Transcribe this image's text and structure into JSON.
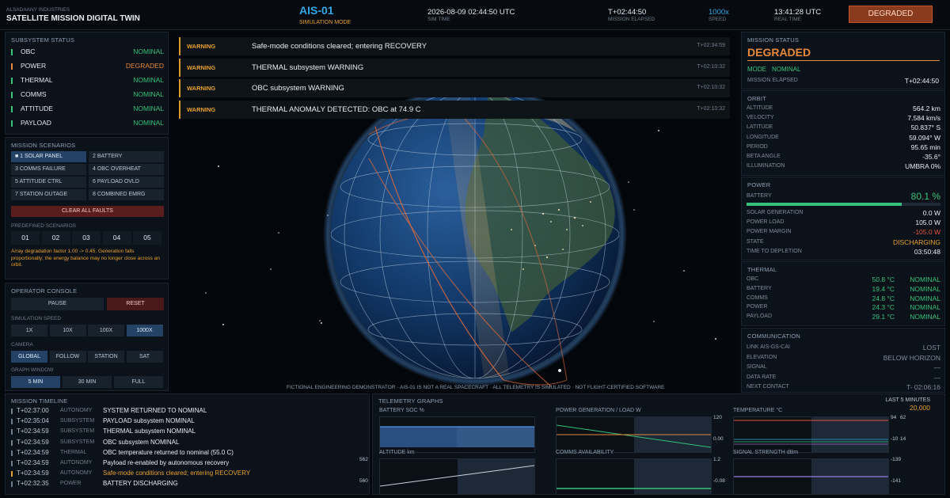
{
  "header": {
    "org": "ALSADAANY INDUSTRIES",
    "app_title": "SATELLITE MISSION DIGITAL TWIN",
    "sat_id": "AIS-01",
    "mode": "SIMULATION MODE",
    "sim_time": "2026-08-09 02:44:50 UTC",
    "sim_time_label": "SIM TIME",
    "elapsed": "T+02:44:50",
    "elapsed_label": "MISSION ELAPSED",
    "speed": "1000x",
    "speed_label": "SPEED",
    "real_time": "13:41:28 UTC",
    "real_time_label": "REAL TIME",
    "status_badge": "DEGRADED"
  },
  "subsystems": {
    "title": "SUBSYSTEM STATUS",
    "items": [
      {
        "name": "OBC",
        "status": "NOMINAL"
      },
      {
        "name": "POWER",
        "status": "DEGRADED"
      },
      {
        "name": "THERMAL",
        "status": "NOMINAL"
      },
      {
        "name": "COMMS",
        "status": "NOMINAL"
      },
      {
        "name": "ATTITUDE",
        "status": "NOMINAL"
      },
      {
        "name": "PAYLOAD",
        "status": "NOMINAL"
      }
    ]
  },
  "scenarios": {
    "title": "MISSION SCENARIOS",
    "items": [
      "■ 1 SOLAR PANEL",
      "2 BATTERY",
      "3 COMMS FAILURE",
      "4 OBC OVERHEAT",
      "5 ATTITUDE CTRL",
      "6 PAYLOAD OVLD",
      "7 STATION OUTAGE",
      "8 COMBINED EMRG"
    ],
    "clear_label": "CLEAR ALL FAULTS",
    "predefined_label": "PREDEFINED SCENARIOS",
    "predefined": [
      "01",
      "02",
      "03",
      "04",
      "05"
    ],
    "note": "Array degradation factor 1.00 -> 0.45. Generation falls proportionally; the energy balance may no longer close across an orbit."
  },
  "console": {
    "title": "OPERATOR CONSOLE",
    "pause": "PAUSE",
    "reset": "RESET",
    "speed_label": "SIMULATION SPEED",
    "speeds": [
      "1X",
      "10X",
      "100X",
      "1000X"
    ],
    "camera_label": "CAMERA",
    "cameras": [
      "GLOBAL",
      "FOLLOW",
      "STATION",
      "SAT"
    ],
    "window_label": "GRAPH WINDOW",
    "windows": [
      "5 MIN",
      "30 MIN",
      "FULL"
    ]
  },
  "warnings": [
    {
      "level": "WARNING",
      "msg": "Safe-mode conditions cleared; entering RECOVERY",
      "time": "T+02:34:59"
    },
    {
      "level": "WARNING",
      "msg": "THERMAL subsystem WARNING",
      "time": "T+02:10:32"
    },
    {
      "level": "WARNING",
      "msg": "OBC subsystem WARNING",
      "time": "T+02:10:32"
    },
    {
      "level": "WARNING",
      "msg": "THERMAL ANOMALY DETECTED: OBC at 74.9 C",
      "time": "T+02:10:32"
    }
  ],
  "disclaimer": "FICTIONAL ENGINEERING DEMONSTRATOR  ·  AIS-01 IS NOT A REAL SPACECRAFT  ·  ALL TELEMETRY IS SIMULATED  ·  NOT FLIGHT-CERTIFIED SOFTWARE",
  "mission_status": {
    "title": "MISSION STATUS",
    "state": "DEGRADED",
    "mode_label": "MODE",
    "mode": "NOMINAL",
    "elapsed_label": "MISSION ELAPSED",
    "elapsed": "T+02:44:50"
  },
  "orbit": {
    "title": "ORBIT",
    "rows": [
      {
        "k": "ALTITUDE",
        "v": "564.2 km"
      },
      {
        "k": "VELOCITY",
        "v": "7.584 km/s"
      },
      {
        "k": "LATITUDE",
        "v": "50.837° S"
      },
      {
        "k": "LONGITUDE",
        "v": "59.094° W"
      },
      {
        "k": "PERIOD",
        "v": "95.65 min"
      },
      {
        "k": "BETA ANGLE",
        "v": "-35.6°"
      }
    ],
    "illum_label": "ILLUMINATION",
    "illum": "UMBRA  0%"
  },
  "power": {
    "title": "POWER",
    "battery_label": "BATTERY",
    "battery": "80.1 %",
    "battery_fraction": 0.801,
    "rows": [
      {
        "k": "SOLAR GENERATION",
        "v": "0.0 W"
      },
      {
        "k": "POWER LOAD",
        "v": "105.0 W"
      },
      {
        "k": "POWER MARGIN",
        "v": "-105.0 W"
      },
      {
        "k": "STATE",
        "v": "DISCHARGING"
      },
      {
        "k": "TIME TO DEPLETION",
        "v": "03:50:48"
      }
    ]
  },
  "thermal": {
    "title": "THERMAL",
    "rows": [
      {
        "k": "OBC",
        "t": "50.8 °C",
        "s": "NOMINAL"
      },
      {
        "k": "BATTERY",
        "t": "19.4 °C",
        "s": "NOMINAL"
      },
      {
        "k": "COMMS",
        "t": "24.8 °C",
        "s": "NOMINAL"
      },
      {
        "k": "POWER",
        "t": "24.3 °C",
        "s": "NOMINAL"
      },
      {
        "k": "PAYLOAD",
        "t": "29.1 °C",
        "s": "NOMINAL"
      }
    ]
  },
  "comms": {
    "title": "COMMUNICATION",
    "rows": [
      {
        "k": "LINK  AIS-GS-CAI",
        "v": "LOST"
      },
      {
        "k": "ELEVATION",
        "v": "BELOW HORIZON"
      },
      {
        "k": "SIGNAL",
        "v": "—"
      },
      {
        "k": "DATA RATE",
        "v": "—"
      },
      {
        "k": "NEXT CONTACT",
        "v": "T- 02:06:16"
      }
    ]
  },
  "timeline": {
    "title": "MISSION TIMELINE",
    "rows": [
      {
        "t": "T+02:37:00",
        "c": "AUTONOMY",
        "m": "SYSTEM RETURNED TO NOMINAL",
        "color": "#6d7d8c"
      },
      {
        "t": "T+02:35:04",
        "c": "SUBSYSTEM",
        "m": "PAYLOAD subsystem NOMINAL",
        "color": "#6d7d8c"
      },
      {
        "t": "T+02:34:59",
        "c": "SUBSYSTEM",
        "m": "THERMAL subsystem NOMINAL",
        "color": "#6d7d8c"
      },
      {
        "t": "T+02:34:59",
        "c": "SUBSYSTEM",
        "m": "OBC subsystem NOMINAL",
        "color": "#6d7d8c"
      },
      {
        "t": "T+02:34:59",
        "c": "THERMAL",
        "m": "OBC temperature returned to nominal (55.0 C)",
        "color": "#6d7d8c"
      },
      {
        "t": "T+02:34:59",
        "c": "AUTONOMY",
        "m": "Payload re-enabled by autonomous recovery",
        "color": "#6d7d8c"
      },
      {
        "t": "T+02:34:59",
        "c": "AUTONOMY",
        "m": "Safe-mode conditions cleared; entering RECOVERY",
        "color": "#e8a030"
      },
      {
        "t": "T+02:32:35",
        "c": "POWER",
        "m": "BATTERY DISCHARGING",
        "color": "#6d7d8c"
      }
    ]
  },
  "telemetry": {
    "title": "TELEMETRY GRAPHS",
    "window": "LAST 5 MINUTES",
    "counter": "20,000",
    "graphs": [
      {
        "title": "BATTERY SOC  %",
        "ymax": "",
        "ymin": "",
        "y2max": "",
        "y2min": ""
      },
      {
        "title": "POWER  GENERATION / LOAD  W",
        "ymax": "120",
        "ymin": "0.00",
        "y2max": "",
        "y2min": ""
      },
      {
        "title": "TEMPERATURE  °C",
        "ymax": "94",
        "ymin": "-10",
        "y2max": "62",
        "y2min": "14"
      },
      {
        "title": "ALTITUDE  km",
        "ymax": "",
        "ymin": "",
        "y2max": "562",
        "y2min": "560"
      },
      {
        "title": "COMMS AVAILABILITY",
        "ymax": "1.2",
        "ymin": "-0.08",
        "y2max": "",
        "y2min": ""
      },
      {
        "title": "SIGNAL STRENGTH  dBm",
        "ymax": "-139",
        "ymin": "-141",
        "y2max": "",
        "y2min": ""
      }
    ]
  },
  "colors": {
    "nominal": "#35c27a",
    "degraded": "#e8893a",
    "warning": "#e8a030",
    "accent": "#33a8e6",
    "badge": "#8a3a1e"
  }
}
